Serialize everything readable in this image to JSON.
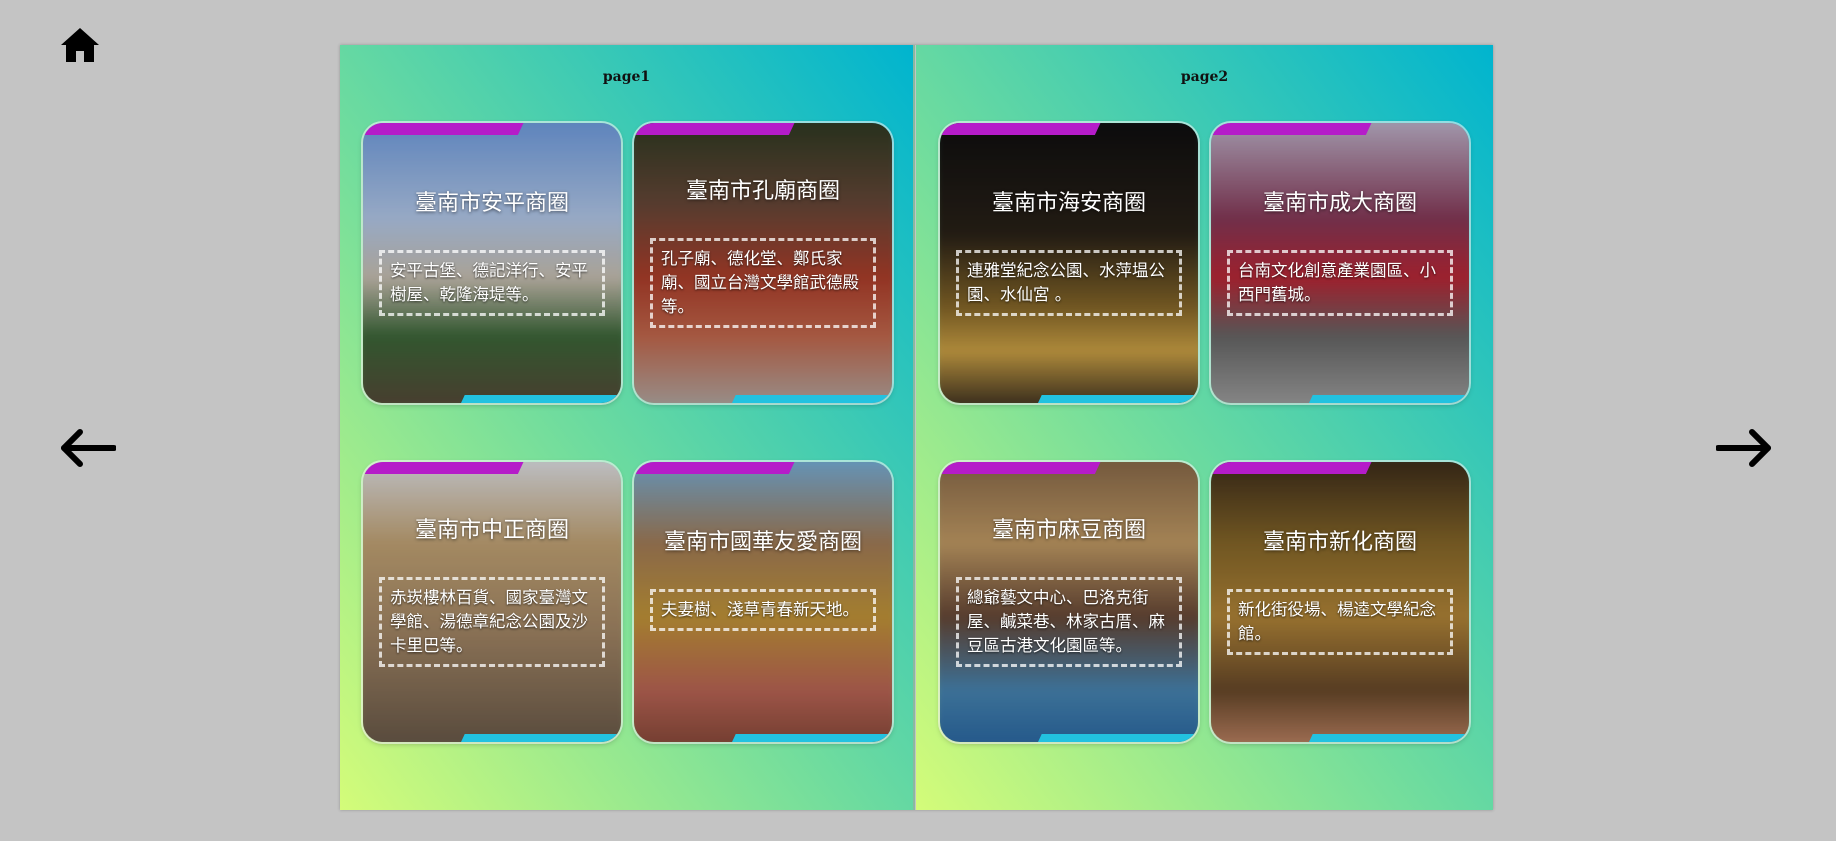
{
  "nav": {
    "home_icon": "home-icon",
    "prev_icon": "arrow-left-icon",
    "next_icon": "arrow-right-icon"
  },
  "pages": [
    {
      "title": "page1",
      "cards": [
        {
          "title": "臺南市安平商圈",
          "desc": "安平古堡、德記洋行、安平樹屋、乾隆海堤等。"
        },
        {
          "title": "臺南市孔廟商圈",
          "desc": "孔子廟、德化堂、鄭氏家廟、國立台灣文學館武德殿等。"
        },
        {
          "title": "臺南市中正商圈",
          "desc": "赤崁樓林百貨、國家臺灣文學館、湯德章紀念公園及沙卡里巴等。"
        },
        {
          "title": "臺南市國華友愛商圈",
          "desc": "夫妻樹、淺草青春新天地。"
        }
      ]
    },
    {
      "title": "page2",
      "cards": [
        {
          "title": "臺南市海安商圈",
          "desc": "連雅堂紀念公園、水萍塭公園、水仙宮 。"
        },
        {
          "title": "臺南市成大商圈",
          "desc": "台南文化創意產業園區、小西門舊城。"
        },
        {
          "title": "臺南市麻豆商圈",
          "desc": "總爺藝文中心、巴洛克街屋、鹹菜巷、林家古厝、麻豆區古港文化園區等。"
        },
        {
          "title": "臺南市新化商圈",
          "desc": "新化街役場、楊逵文學紀念館。"
        }
      ]
    }
  ],
  "colors": {
    "background": "#c4c4c4",
    "accent_magenta": "#b51cc9",
    "accent_cyan": "#22c2e0"
  }
}
